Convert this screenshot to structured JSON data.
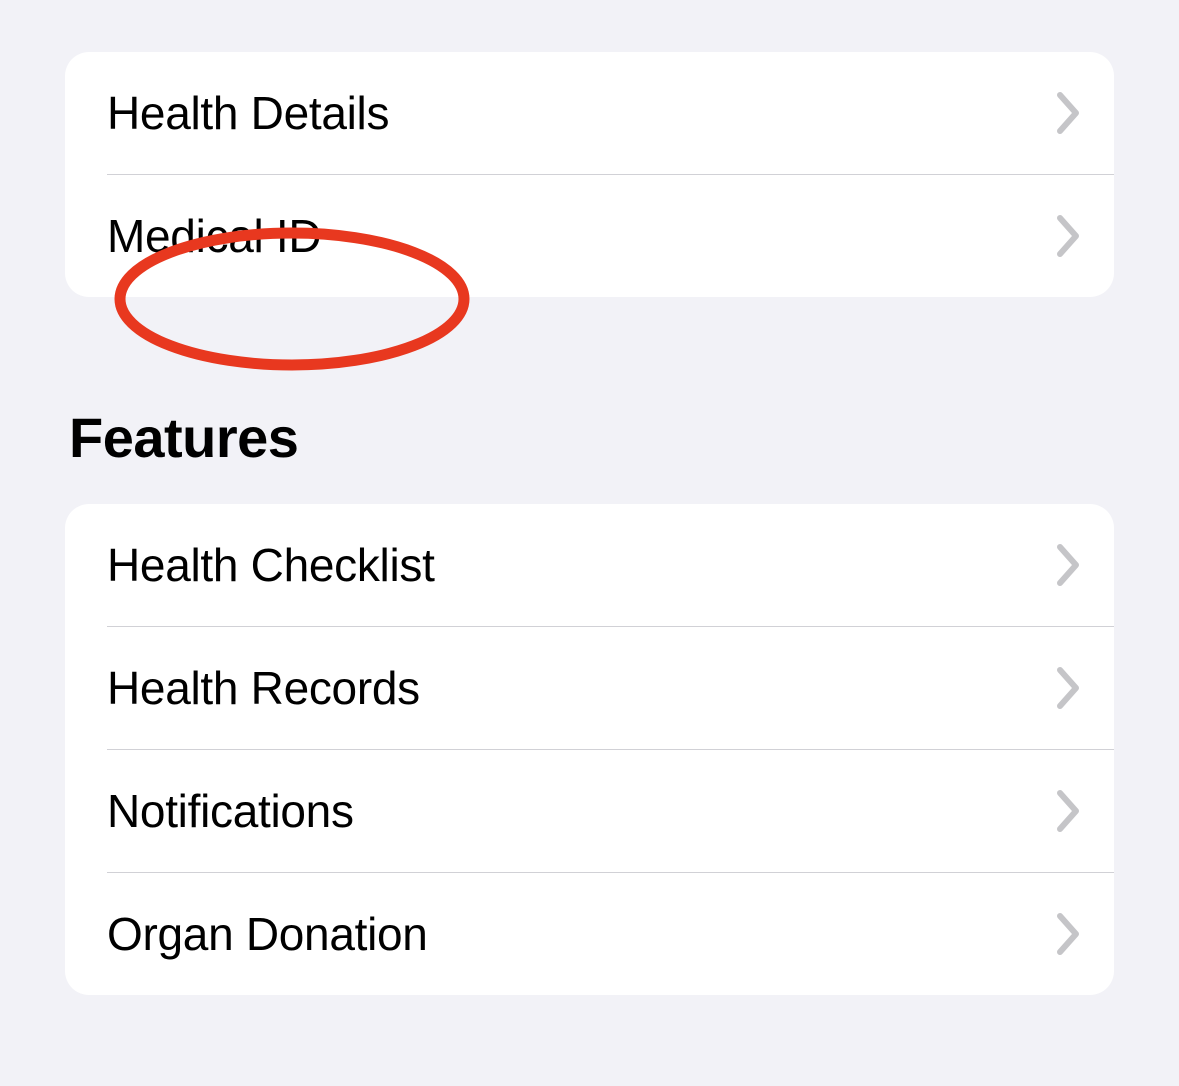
{
  "top_group": {
    "items": [
      {
        "label": "Health Details"
      },
      {
        "label": "Medical ID"
      }
    ]
  },
  "features_section": {
    "title": "Features",
    "items": [
      {
        "label": "Health Checklist"
      },
      {
        "label": "Health Records"
      },
      {
        "label": "Notifications"
      },
      {
        "label": "Organ Donation"
      }
    ]
  },
  "annotation": {
    "highlight_target": "medical-id",
    "ellipse_color": "#e8381f"
  }
}
